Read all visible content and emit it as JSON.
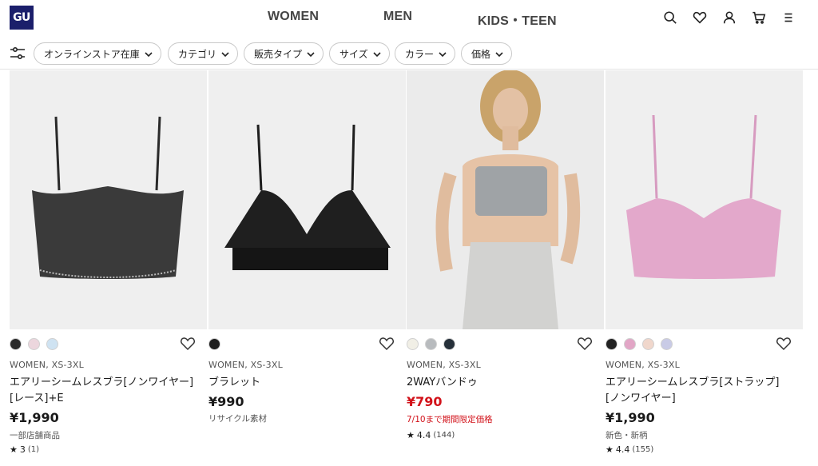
{
  "header": {
    "logo_text": "GU",
    "nav": [
      "WOMEN",
      "MEN",
      "KIDS・TEEN"
    ],
    "icons": [
      "search-icon",
      "heart-icon",
      "account-icon",
      "cart-icon",
      "menu-icon"
    ]
  },
  "filters": {
    "toggle_icon": "filter-sliders-icon",
    "chips": [
      "オンラインストア在庫",
      "カテゴリ",
      "販売タイプ",
      "サイズ",
      "カラー",
      "価格"
    ]
  },
  "products": [
    {
      "swatches": [
        "#2b2b2b",
        "#ecd6dd",
        "#cfe3f2"
      ],
      "meta": "WOMEN, XS-3XL",
      "name": "エアリーシームレスブラ[ノンワイヤー][レース]+E",
      "price": "¥1,990",
      "price_sale": false,
      "note": "一部店舗商品",
      "rating": "3",
      "rating_count": "(1)"
    },
    {
      "swatches": [
        "#1e1e1e"
      ],
      "meta": "WOMEN, XS-3XL",
      "name": "ブラレット",
      "price": "¥990",
      "price_sale": false,
      "note": "リサイクル素材",
      "rating": "",
      "rating_count": ""
    },
    {
      "swatches": [
        "#f1efe6",
        "#b8bbbe",
        "#26303a"
      ],
      "meta": "WOMEN, XS-3XL",
      "name": "2WAYバンドゥ",
      "price": "¥790",
      "price_sale": true,
      "note": "7/10まで期間限定価格",
      "rating": "4.4",
      "rating_count": "(144)"
    },
    {
      "swatches": [
        "#222222",
        "#e2a6c6",
        "#f0d7cc",
        "#c9cbe6"
      ],
      "meta": "WOMEN, XS-3XL",
      "name": "エアリーシームレスブラ[ストラップ][ノンワイヤー]",
      "price": "¥1,990",
      "price_sale": false,
      "note": "新色・新柄",
      "rating": "4.4",
      "rating_count": "(155)"
    }
  ],
  "colors": {
    "brand": "#1b1f6b",
    "sale": "#d2121a"
  }
}
